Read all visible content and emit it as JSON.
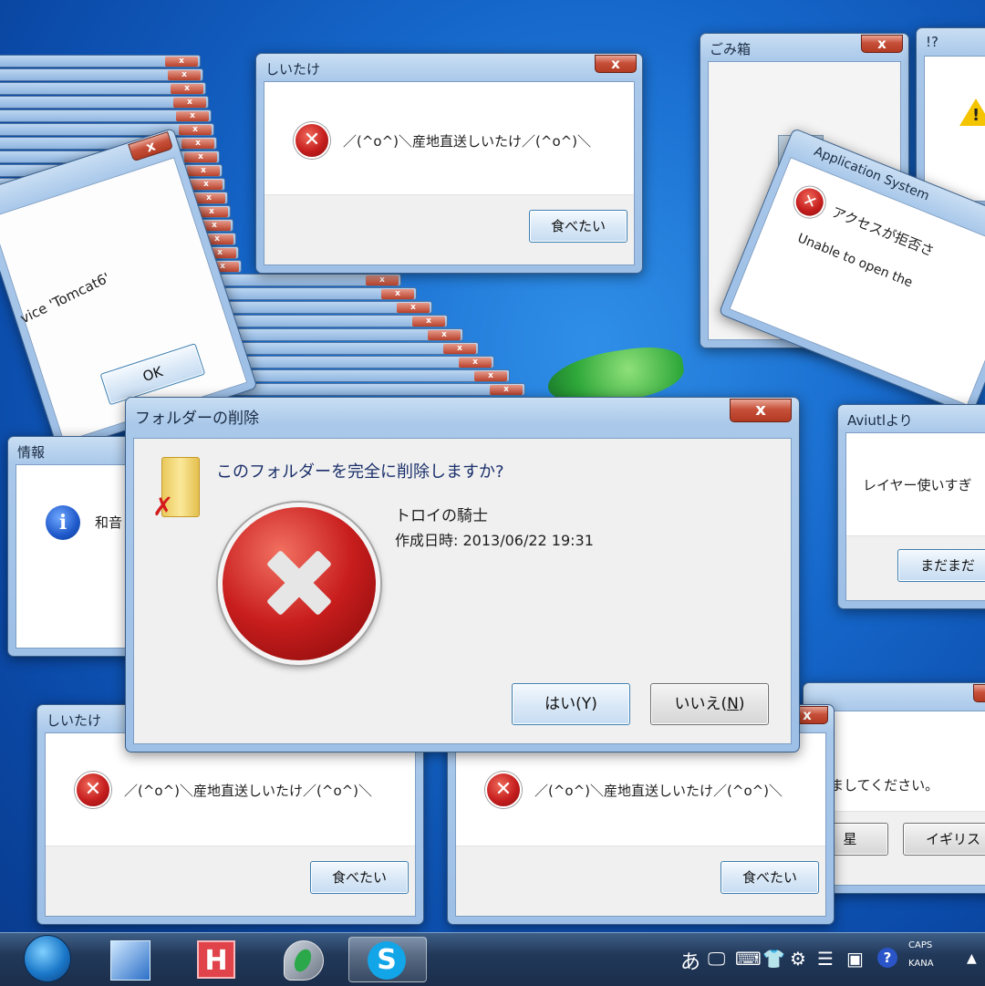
{
  "main_dialog": {
    "title": "フォルダーの削除",
    "close": "x",
    "question": "このフォルダーを完全に削除しますか?",
    "item_name": "トロイの騎士",
    "item_date": "作成日時: 2013/06/22 19:31",
    "yes_button": "はい(Y)",
    "no_button": "いいえ(",
    "no_button_accel": "N",
    "no_button_end": ")"
  },
  "shiitake_top": {
    "title": "しいたけ",
    "close": "x",
    "message": "／(^o^)＼産地直送しいたけ／(^o^)＼",
    "button": "食べたい"
  },
  "shiitake_bl": {
    "title": "しいたけ",
    "close": "x",
    "message": "／(^o^)＼産地直送しいたけ／(^o^)＼",
    "button": "食べたい"
  },
  "shiitake_bm": {
    "message": "／(^o^)＼産地直送しいたけ／(^o^)＼",
    "button": "食べたい"
  },
  "tomcat": {
    "message": "vice 'Tomcat6'",
    "button": "OK",
    "close": "x"
  },
  "recycle": {
    "title": "ごみ箱",
    "close": "x"
  },
  "warn_top": {
    "title": "!?"
  },
  "appsys": {
    "title": "Application System",
    "message_jp": "アクセスが拒否さ",
    "message_en": "Unable to open the"
  },
  "info": {
    "title": "情報",
    "message": "和音"
  },
  "aviutl": {
    "title": "Aviutlより",
    "message": "レイヤー使いすぎ",
    "button": "まだまだ"
  },
  "br_dialog": {
    "message": "ましてください。",
    "button1": "星",
    "button2": "イギリス"
  },
  "mini_label": "x",
  "taskbar": {
    "caps": "CAPS",
    "kana": "KANA",
    "ime": "あ",
    "apps": [
      "media-center-icon",
      "music-player-icon",
      "h-app-icon",
      "shield-app-icon",
      "skype-icon"
    ],
    "skype_letter": "S",
    "h_letter": "H"
  }
}
